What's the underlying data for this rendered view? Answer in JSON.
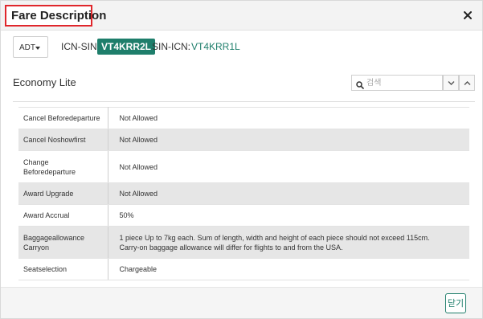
{
  "dialog": {
    "title": "Fare Description",
    "close_label": "닫기"
  },
  "route_bar": {
    "pax_type": "ADT",
    "segments": [
      {
        "route": "ICN-SIN:",
        "fare_basis": "VT4KRR2L"
      },
      {
        "route": "SIN-ICN:",
        "fare_basis": "VT4KRR1L"
      }
    ]
  },
  "fare": {
    "name": "Economy Lite"
  },
  "search": {
    "placeholder": "검색"
  },
  "rules": [
    {
      "label": "Cancel Beforedeparture",
      "value": "Not Allowed"
    },
    {
      "label": "Cancel Noshowfirst",
      "value": "Not Allowed"
    },
    {
      "label": "Change\nBeforedeparture",
      "value": "Not Allowed"
    },
    {
      "label": "Award Upgrade",
      "value": "Not Allowed"
    },
    {
      "label": "Award Accrual",
      "value": "50%"
    },
    {
      "label": "Baggageallowance\nCarryon",
      "value": "1 piece Up to 7kg each. Sum of length, width and height of each piece should not exceed 115cm.\nCarry-on baggage allowance will differ for flights to and from the USA."
    },
    {
      "label": "Seatselection",
      "value": "Chargeable"
    }
  ],
  "colors": {
    "accent": "#1e7e6b",
    "highlight_border": "#e0262b",
    "row_alt": "#e6e6e6"
  }
}
